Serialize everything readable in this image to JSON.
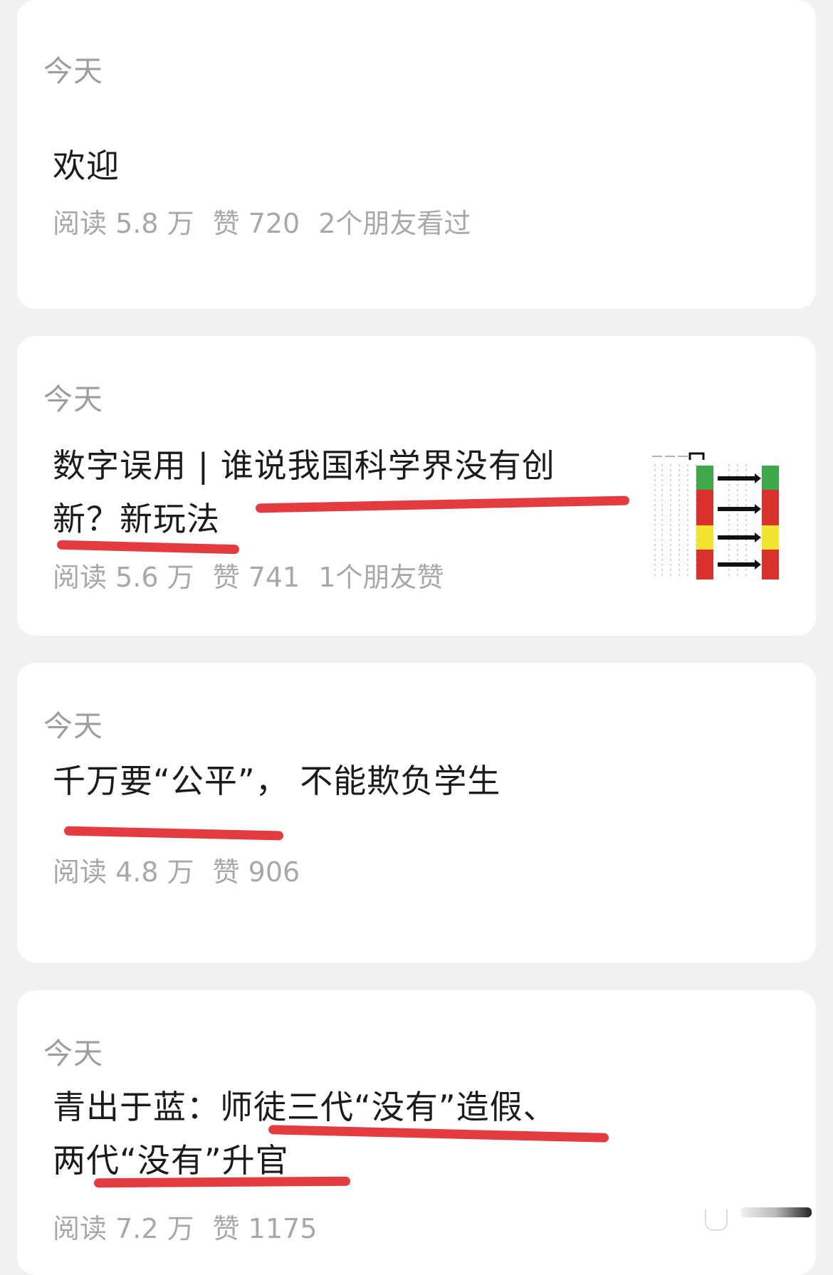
{
  "posts": [
    {
      "date": "今天",
      "title_line1": "欢迎",
      "title_line2": "",
      "meta": {
        "reads": "阅读 5.8 万",
        "likes": "赞 720",
        "friends": "2个朋友看过"
      }
    },
    {
      "date": "今天",
      "title_line1": "数字误用 | 谁说我国科学界没有创",
      "title_line2": "新？新玩法",
      "meta": {
        "reads": "阅读 5.6 万",
        "likes": "赞 741",
        "friends": "1个朋友赞"
      }
    },
    {
      "date": "今天",
      "title_line1": "千万要“公平”， 不能欺负学生",
      "title_line2": "",
      "meta": {
        "reads": "阅读 4.8 万",
        "likes": "赞 906",
        "friends": ""
      }
    },
    {
      "date": "今天",
      "title_line1": "青出于蓝：师徒三代“没有”造假、",
      "title_line2": "两代“没有”升官",
      "meta": {
        "reads": "阅读 7.2 万",
        "likes": "赞 1175",
        "friends": ""
      }
    }
  ],
  "colors": {
    "underline": "#e33b3f",
    "meta_text": "#a8a8a8",
    "title_text": "#1b1b1b"
  },
  "thumbnail": {
    "icon": "table-chart-thumbnail"
  }
}
